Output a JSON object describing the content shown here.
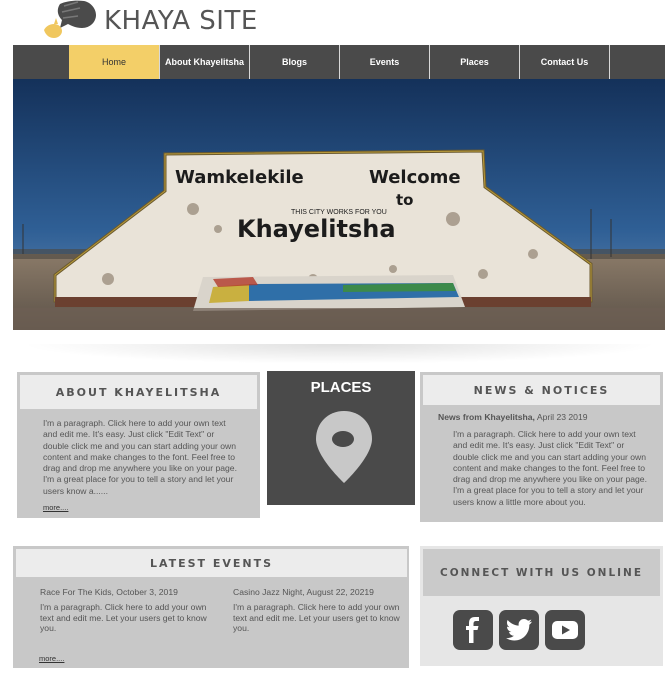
{
  "site": {
    "title": "KHAYA SITE"
  },
  "nav": {
    "items": [
      {
        "label": "Home"
      },
      {
        "label": "About Khayelitsha"
      },
      {
        "label": "Blogs"
      },
      {
        "label": "Events"
      },
      {
        "label": "Places"
      },
      {
        "label": "Contact Us"
      }
    ],
    "active_index": 0
  },
  "hero": {
    "sign_left": "Wamkelekile",
    "sign_right": "Welcome",
    "sign_to": "to",
    "sign_small": "THIS CITY WORKS FOR YOU",
    "sign_main": "Khayelitsha"
  },
  "about": {
    "heading": "ABOUT KHAYELITSHA",
    "text": "I'm a paragraph. Click here to add your own text and edit me. It's easy. Just click \"Edit Text\" or double click me and you can start adding your own content and make changes to the font. Feel free to drag and drop me anywhere you like on your page. I'm a great place for you to tell a story and let your users know a......",
    "more": "more...."
  },
  "places": {
    "title": "PLACES"
  },
  "news": {
    "heading": "NEWS & NOTICES",
    "source": "News from Khayelitsha,",
    "date": " April 23 2019",
    "text": "I'm a paragraph. Click here to add your own text and edit me. It's easy. Just click \"Edit Text\" or double click me and you can start adding your own content and make changes to the font. Feel free to drag and drop me anywhere you like on your page. I'm a great place for you to tell a story and let your users know a little more about you."
  },
  "events": {
    "heading": "LATEST EVENTS",
    "items": [
      {
        "title": "Race For The Kids,  October 3, 2019",
        "text": "I'm a paragraph. Click here to add your own text and edit me. Let your users get to know you."
      },
      {
        "title": "Casino Jazz Night,  August 22, 20219",
        "text": "I'm a paragraph. Click here to add your own text and edit me. Let your users get to know you."
      }
    ],
    "more": "more...."
  },
  "connect": {
    "heading": "CONNECT WITH US ONLINE",
    "icons": [
      "facebook-icon",
      "twitter-icon",
      "youtube-icon"
    ]
  },
  "colors": {
    "accent": "#f3cf68",
    "dark": "#4a4a4a",
    "card": "#c8c8c8"
  }
}
